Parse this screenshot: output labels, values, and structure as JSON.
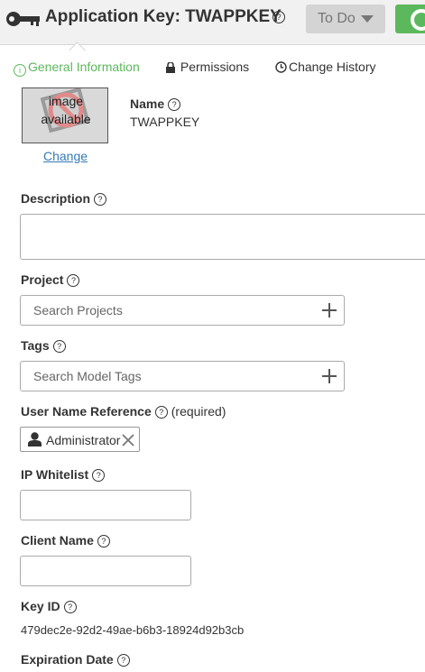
{
  "header": {
    "title": "Application Key: TWAPPKEY",
    "help_glyph": "?",
    "state_button": "To Do",
    "icons": [
      "key-icon",
      "help-icon",
      "caret-down-icon",
      "circle-icon"
    ],
    "colors": {
      "accent": "#5cb85c",
      "header_bg": "#f1f1f1",
      "link": "#337ab7"
    }
  },
  "tabs": [
    {
      "label": "General Information",
      "icon": "info-icon",
      "active": true
    },
    {
      "label": "Permissions",
      "icon": "lock-icon",
      "active": false
    },
    {
      "label": "Change History",
      "icon": "clock-icon",
      "active": false
    }
  ],
  "avatar": {
    "line1": "image",
    "line2": "available",
    "change_link": "Change"
  },
  "name": {
    "label": "Name",
    "value": "TWAPPKEY"
  },
  "description": {
    "label": "Description",
    "value": ""
  },
  "project": {
    "label": "Project",
    "placeholder": "Search Projects"
  },
  "tags": {
    "label": "Tags",
    "placeholder": "Search Model Tags"
  },
  "user_name_reference": {
    "label": "User Name Reference",
    "required": "(required)",
    "chip": "Administrator"
  },
  "ip_whitelist": {
    "label": "IP Whitelist",
    "value": ""
  },
  "client_name": {
    "label": "Client Name",
    "value": ""
  },
  "key_id": {
    "label": "Key ID",
    "value": "479dec2e-92d2-49ae-b6b3-18924d92b3cb"
  },
  "expiration_date": {
    "label": "Expiration Date"
  }
}
